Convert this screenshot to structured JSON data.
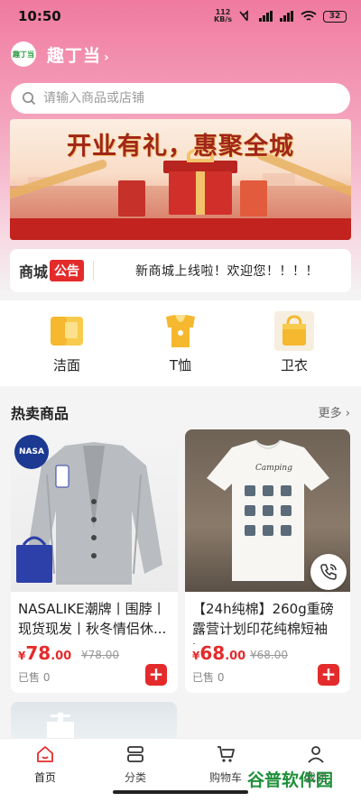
{
  "status_bar": {
    "time": "10:50",
    "net_speed_value": "112",
    "net_speed_unit": "KB/s",
    "battery": "32"
  },
  "header": {
    "store_name": "趣丁当",
    "chevron": "›",
    "logo_text": "趣丁当"
  },
  "search": {
    "placeholder": "请输入商品或店铺"
  },
  "banner": {
    "headline": "开业有礼，惠聚全城"
  },
  "notice": {
    "label_left": "商城",
    "label_right": "公告",
    "text": "新商城上线啦！欢迎您！！！！"
  },
  "categories": [
    {
      "label": "洁面",
      "icon": "category-face-wash-icon"
    },
    {
      "label": "T恤",
      "icon": "category-tshirt-icon"
    },
    {
      "label": "卫衣",
      "icon": "category-hoodie-icon"
    }
  ],
  "hot_section": {
    "title": "热卖商品",
    "more": "更多 ›"
  },
  "products": [
    {
      "name": "NASALIKE潮牌丨围脖丨现货现发丨秋冬情侣休...",
      "currency": "¥",
      "price_int": "78",
      "price_dec": ".00",
      "original_price": "¥78.00",
      "sold": "已售 0",
      "badge": "NASA"
    },
    {
      "name": "【24h纯棉】260g重磅露营计划印花纯棉短袖t...",
      "currency": "¥",
      "price_int": "68",
      "price_dec": ".00",
      "original_price": "¥68.00",
      "sold": "已售 0",
      "shirt_print": "Camping"
    }
  ],
  "tabbar": [
    {
      "label": "首页",
      "icon": "home-icon"
    },
    {
      "label": "分类",
      "icon": "category-icon"
    },
    {
      "label": "购物车",
      "icon": "cart-icon"
    },
    {
      "label": "我的",
      "icon": "user-icon"
    }
  ],
  "watermark": "谷普软件园",
  "colors": {
    "accent": "#e42b2b",
    "header_pink": "#f07aa0",
    "category_yellow": "#f5b82e"
  }
}
